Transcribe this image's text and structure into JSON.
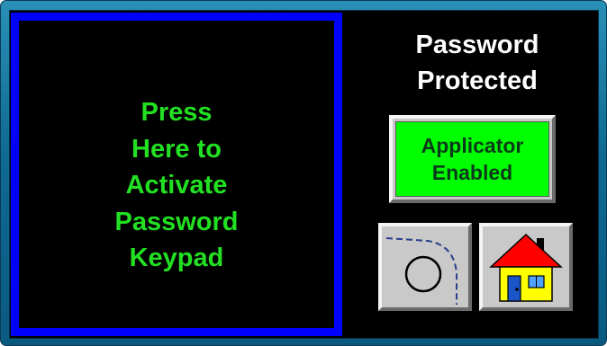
{
  "keypad_panel": {
    "label": "Press\nHere to\nActivate\nPassword\nKeypad"
  },
  "status": {
    "title": "Password\nProtected"
  },
  "applicator_button": {
    "label": "Applicator\nEnabled"
  },
  "icons": {
    "roller": "roller-path-icon",
    "home": "home-icon"
  },
  "colors": {
    "background": "#000000",
    "keypad_border": "#0000ff",
    "keypad_text": "#22e022",
    "title_text": "#ffffff",
    "applicator_fill": "#00ff00",
    "button_face": "#c8c8c8",
    "frame": "#0e6a93"
  }
}
